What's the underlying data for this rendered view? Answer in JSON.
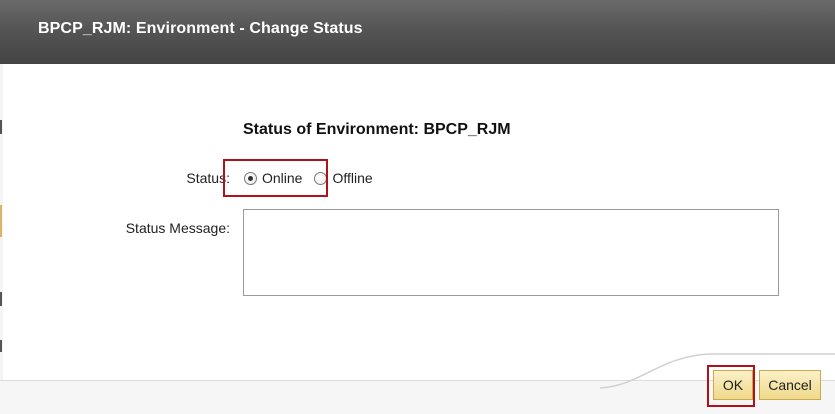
{
  "dialog": {
    "title": "BPCP_RJM: Environment - Change Status",
    "heading": "Status of Environment: BPCP_RJM",
    "status_label": "Status:",
    "status_options": [
      {
        "label": "Online",
        "checked": true
      },
      {
        "label": "Offline",
        "checked": false
      }
    ],
    "message_label": "Status Message:",
    "message_value": ""
  },
  "buttons": {
    "ok_label": "OK",
    "cancel_label": "Cancel"
  },
  "colors": {
    "titlebar": "#555555",
    "highlight": "#b11217",
    "button_bg": "#f0d98a"
  }
}
